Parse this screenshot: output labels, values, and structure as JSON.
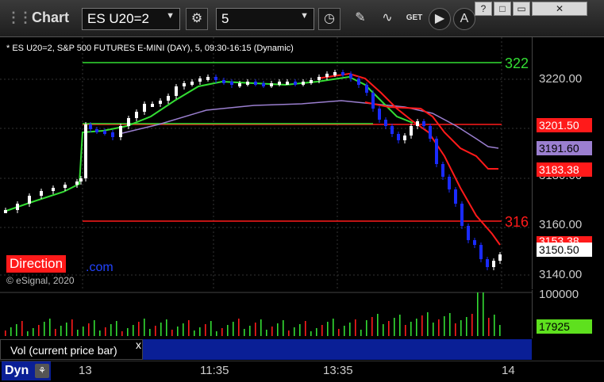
{
  "toolbar": {
    "app_title": "Chart",
    "symbol": "ES U20=2",
    "interval": "5",
    "icons": [
      "gear-icon",
      "clock-icon",
      "pencil-icon",
      "study-icon",
      "get-icon",
      "play-icon",
      "letter-a-icon"
    ],
    "get_label": "GET",
    "window_buttons": [
      "?",
      "□",
      "▭",
      "✕"
    ]
  },
  "chart": {
    "series_description": "* ES U20=2, S&P 500 FUTURES E-MINI (DAY), 5, 09:30-16:15 (Dynamic)",
    "direction_label": "Direction",
    "direction_suffix": ".com",
    "copyright": "© eSignal, 2020",
    "level_labels": {
      "upper": "322",
      "lower": "316"
    },
    "price_ticks": [
      "3220.00",
      "3200.00",
      "3180.00",
      "3160.00",
      "3140.00"
    ],
    "price_tags": [
      {
        "text": "3201.50",
        "bg": "#ff1a1a",
        "fg": "#ffffff"
      },
      {
        "text": "3191.60",
        "bg": "#9b7fd0",
        "fg": "#000000"
      },
      {
        "text": "3183.38",
        "bg": "#ff1a1a",
        "fg": "#ffffff"
      },
      {
        "text": "3153.38",
        "bg": "#ff1a1a",
        "fg": "#ffffff"
      },
      {
        "text": "3150.50",
        "bg": "#ffffff",
        "fg": "#000000"
      }
    ],
    "colors": {
      "up": "#ffffff",
      "down": "#1a2bff",
      "green": "#33dd33",
      "red": "#ff1a1a",
      "purple": "#9b7fd0"
    }
  },
  "volume": {
    "legend_label": "Vol (current price bar)",
    "close_symbol": "x",
    "scale_label": "100000",
    "current_value": "17925",
    "current_bg": "#5ee01e"
  },
  "time_axis": {
    "panel_label": "Dyn",
    "ticks": [
      "13",
      "11:35",
      "13:35",
      "14"
    ]
  }
}
